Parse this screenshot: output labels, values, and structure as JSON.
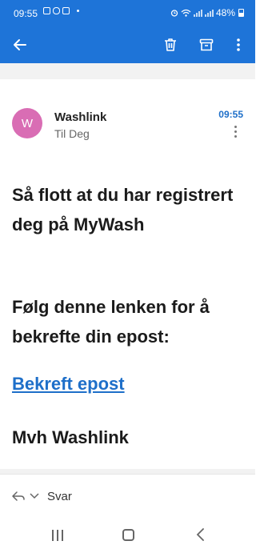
{
  "status_bar": {
    "time": "09:55",
    "battery": "48%"
  },
  "app_bar": {
    "back_icon": "arrow-left-icon",
    "delete_icon": "trash-icon",
    "archive_icon": "archive-icon",
    "more_icon": "more-vertical-icon",
    "color": "#1e74d8"
  },
  "message": {
    "avatar_letter": "W",
    "avatar_color": "#d96db4",
    "sender": "Washlink",
    "recipient": "Til Deg",
    "time": "09:55",
    "paragraph_1": "Så flott at du har registrert deg på MyWash",
    "paragraph_2": "Følg denne lenken for å bekrefte din epost:",
    "link_text": "Bekreft epost",
    "link_color": "#1e6fc9",
    "signature": "Mvh Washlink"
  },
  "reply_bar": {
    "label": "Svar"
  }
}
